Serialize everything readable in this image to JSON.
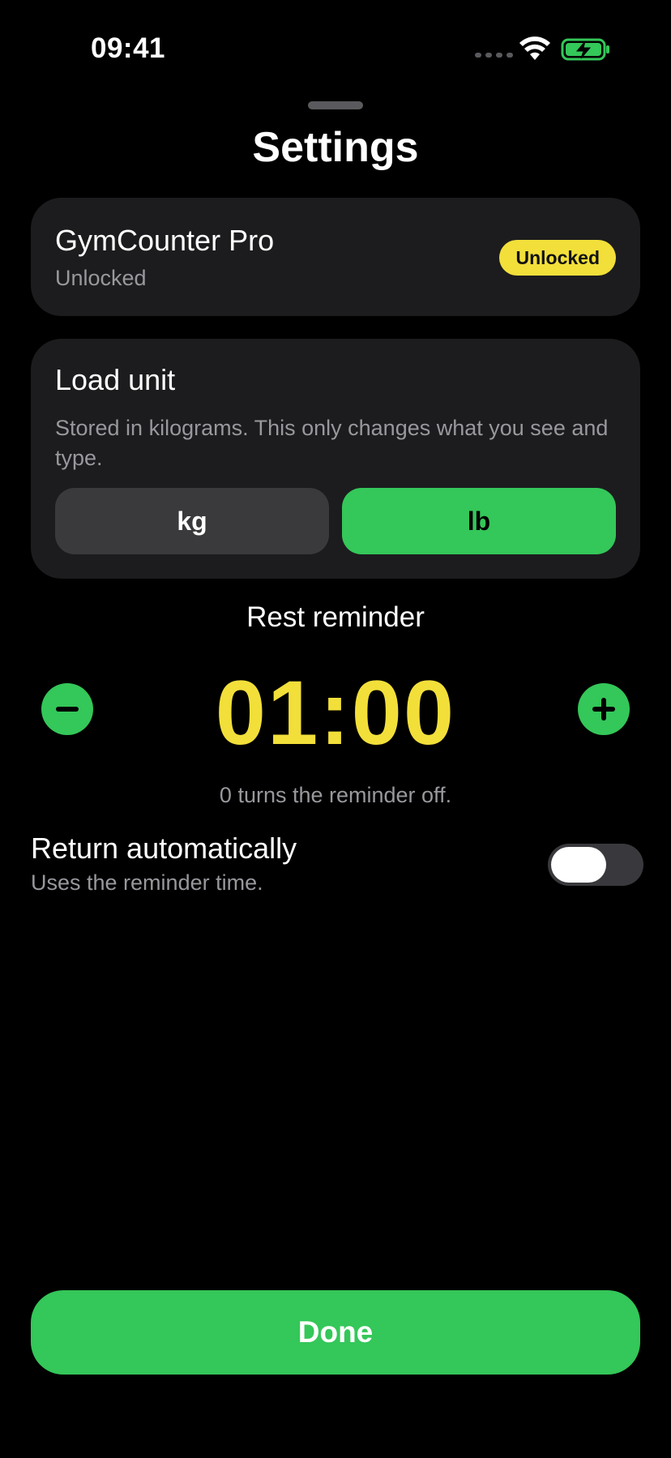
{
  "status_bar": {
    "time": "09:41",
    "icons": [
      "signal-dots-icon",
      "wifi-icon",
      "battery-charging-icon"
    ]
  },
  "sheet": {
    "title": "Settings"
  },
  "pro_card": {
    "title": "GymCounter Pro",
    "subtitle": "Unlocked",
    "badge": "Unlocked"
  },
  "load_unit": {
    "title": "Load unit",
    "description": "Stored in kilograms. This only changes what you see and type.",
    "options": [
      "kg",
      "lb"
    ],
    "selected": "lb"
  },
  "rest_reminder": {
    "label": "Rest reminder",
    "value": "01:00",
    "hint": "0 turns the reminder off.",
    "decrement_icon": "minus-icon",
    "increment_icon": "plus-icon"
  },
  "return_automatically": {
    "title": "Return automatically",
    "subtitle": "Uses the reminder time.",
    "enabled": false
  },
  "done_label": "Done",
  "colors": {
    "accent_green": "#34c759",
    "accent_yellow": "#f2df3a",
    "card_bg": "#1c1c1e",
    "secondary_text": "#98989d"
  }
}
